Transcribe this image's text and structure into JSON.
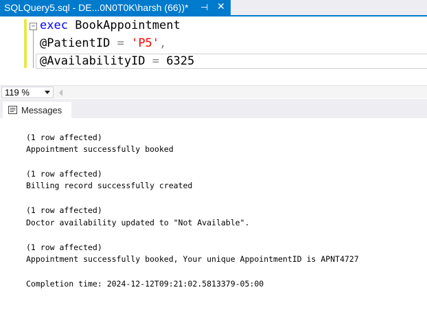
{
  "tab": {
    "title": "SQLQuery5.sql - DE...0N0T0K\\harsh (66))*",
    "pin_glyph": "⊣",
    "close_glyph": "✕"
  },
  "editor": {
    "fold_glyph": "−",
    "line1": {
      "keyword": "exec",
      "procedure": " BookAppointment"
    },
    "line2": {
      "param": "@PatientID",
      "op": " = ",
      "value": "'P5'",
      "comma": ","
    },
    "line3": {
      "param": "@AvailabilityID",
      "op": " = ",
      "value": "6325"
    }
  },
  "zoom": {
    "value": "119 %"
  },
  "results": {
    "tab_label": "Messages"
  },
  "messages": {
    "lines": [
      "(1 row affected)",
      "Appointment successfully booked",
      "(1 row affected)",
      "Billing record successfully created",
      "(1 row affected)",
      "Doctor availability updated to \"Not Available\".",
      "(1 row affected)",
      "Appointment successfully booked, Your unique AppointmentID is APNT4727",
      "Completion time: 2024-12-12T09:21:02.5813379-05:00"
    ]
  },
  "colors": {
    "accent": "#007acc",
    "keyword": "#0000ff",
    "string": "#ff0000",
    "operator": "#808080"
  },
  "icons": [
    "pin-icon",
    "close-icon",
    "collapse-icon",
    "chevron-down-icon",
    "scroll-left-icon",
    "messages-icon"
  ]
}
